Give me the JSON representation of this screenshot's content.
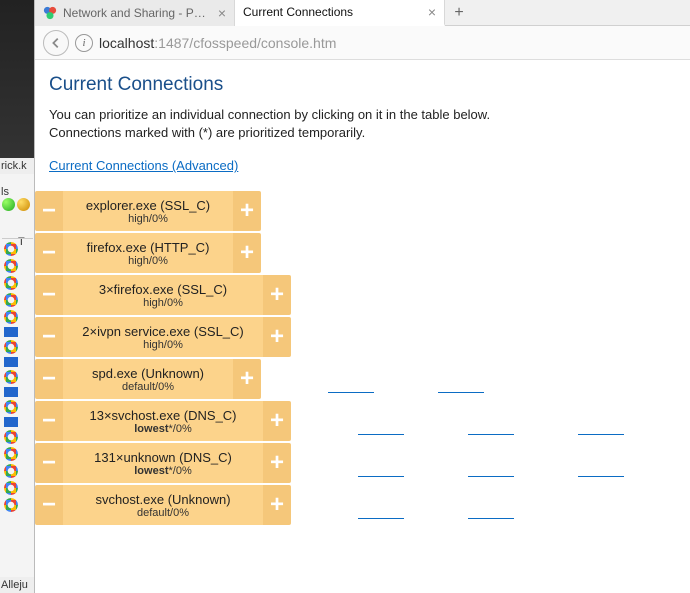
{
  "left_partial": {
    "rick": "rick.k",
    "ls": "ls",
    "t": "T",
    "alle": "Alleju"
  },
  "tabs": {
    "inactive": "Network and Sharing - Po…",
    "active": "Current Connections"
  },
  "url": {
    "host": "localhost",
    "rest": ":1487/cfosspeed/console.htm"
  },
  "page": {
    "title": "Current Connections",
    "desc1": "You can prioritize an individual connection by clicking on it in the table below.",
    "desc2": "Connections marked with (*) are prioritized temporarily.",
    "advlink": "Current Connections (Advanced)"
  },
  "btn": {
    "minus": "−",
    "plus": "+"
  },
  "rows": [
    {
      "name": "explorer.exe (SSL_C)",
      "meta_prefix": "",
      "meta_mid": "high",
      "meta_suffix": "/0%",
      "wide": false,
      "links": 0
    },
    {
      "name": "firefox.exe (HTTP_C)",
      "meta_prefix": "",
      "meta_mid": "high",
      "meta_suffix": "/0%",
      "wide": false,
      "links": 0
    },
    {
      "name": "3×firefox.exe (SSL_C)",
      "meta_prefix": "",
      "meta_mid": "high",
      "meta_suffix": "/0%",
      "wide": true,
      "links": 0
    },
    {
      "name": "2×ivpn service.exe (SSL_C)",
      "meta_prefix": "",
      "meta_mid": "high",
      "meta_suffix": "/0%",
      "wide": true,
      "links": 0
    },
    {
      "name": "spd.exe (Unknown)",
      "meta_prefix": "",
      "meta_mid": "default",
      "meta_suffix": "/0%",
      "wide": false,
      "links": 2
    },
    {
      "name": "13×svchost.exe (DNS_C)",
      "meta_prefix": "lowest",
      "meta_mid": "*",
      "meta_suffix": "/0%",
      "wide": true,
      "links": 3,
      "bold": true
    },
    {
      "name": "131×unknown (DNS_C)",
      "meta_prefix": "lowest",
      "meta_mid": "*",
      "meta_suffix": "/0%",
      "wide": true,
      "links": 3,
      "bold": true
    },
    {
      "name": "svchost.exe (Unknown)",
      "meta_prefix": "",
      "meta_mid": "default",
      "meta_suffix": "/0%",
      "wide": true,
      "links": 2
    }
  ]
}
